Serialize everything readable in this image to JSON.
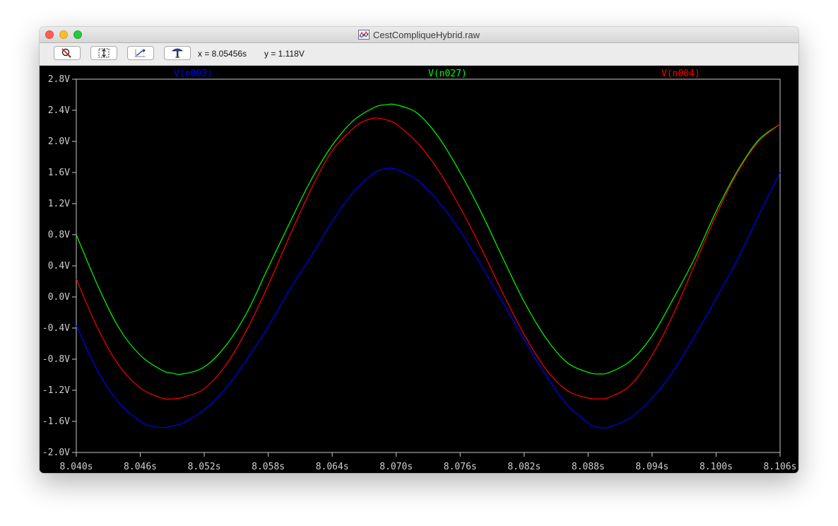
{
  "window": {
    "title": "CestCompliqueHybrid.raw"
  },
  "toolbar": {
    "buttons": [
      {
        "icon": "zoom-cancel-icon"
      },
      {
        "icon": "autorange-icon"
      },
      {
        "icon": "zoom-fit-icon"
      },
      {
        "icon": "probe-icon"
      }
    ],
    "x_readout": "x = 8.05456s",
    "y_readout": "y = 1.118V"
  },
  "chart_data": {
    "type": "line",
    "xlim": [
      8.04,
      8.106
    ],
    "ylim": [
      -2.0,
      2.8
    ],
    "x_ticks": [
      "8.040s",
      "8.046s",
      "8.052s",
      "8.058s",
      "8.064s",
      "8.070s",
      "8.076s",
      "8.082s",
      "8.088s",
      "8.094s",
      "8.100s",
      "8.106s"
    ],
    "y_ticks": [
      "2.8V",
      "2.4V",
      "2.0V",
      "1.6V",
      "1.2V",
      "0.8V",
      "0.4V",
      "0.0V",
      "-0.4V",
      "-0.8V",
      "-1.2V",
      "-1.6V",
      "-2.0V"
    ],
    "grid": false,
    "series": [
      {
        "name": "V(n003)",
        "color": "#0000ff",
        "x": [
          8.04,
          8.042,
          8.044,
          8.046,
          8.047,
          8.048,
          8.049,
          8.05,
          8.052,
          8.054,
          8.056,
          8.058,
          8.06,
          8.062,
          8.064,
          8.066,
          8.068,
          8.069,
          8.07,
          8.072,
          8.074,
          8.076,
          8.078,
          8.08,
          8.082,
          8.084,
          8.086,
          8.088,
          8.089,
          8.09,
          8.092,
          8.094,
          8.096,
          8.098,
          8.1,
          8.102,
          8.104,
          8.106
        ],
        "y": [
          -0.37,
          -0.95,
          -1.36,
          -1.6,
          -1.66,
          -1.68,
          -1.66,
          -1.62,
          -1.45,
          -1.18,
          -0.8,
          -0.38,
          0.09,
          0.52,
          0.97,
          1.35,
          1.6,
          1.65,
          1.64,
          1.5,
          1.22,
          0.85,
          0.4,
          -0.07,
          -0.55,
          -1.0,
          -1.38,
          -1.62,
          -1.68,
          -1.67,
          -1.55,
          -1.3,
          -0.95,
          -0.5,
          -0.02,
          0.48,
          1.05,
          1.6
        ]
      },
      {
        "name": "V(n027)",
        "color": "#00ff00",
        "x": [
          8.04,
          8.042,
          8.044,
          8.046,
          8.048,
          8.049,
          8.05,
          8.052,
          8.054,
          8.056,
          8.058,
          8.06,
          8.062,
          8.064,
          8.066,
          8.068,
          8.069,
          8.07,
          8.072,
          8.074,
          8.076,
          8.078,
          8.08,
          8.082,
          8.084,
          8.086,
          8.088,
          8.089,
          8.09,
          8.092,
          8.094,
          8.096,
          8.098,
          8.1,
          8.102,
          8.104,
          8.106
        ],
        "y": [
          0.8,
          0.15,
          -0.4,
          -0.75,
          -0.94,
          -0.98,
          -0.99,
          -0.9,
          -0.63,
          -0.2,
          0.38,
          0.95,
          1.5,
          1.95,
          2.27,
          2.44,
          2.47,
          2.47,
          2.36,
          2.05,
          1.6,
          1.08,
          0.5,
          -0.06,
          -0.52,
          -0.84,
          -0.97,
          -0.99,
          -0.97,
          -0.82,
          -0.5,
          -0.02,
          0.5,
          1.1,
          1.62,
          2.02,
          2.22
        ]
      },
      {
        "name": "V(n004)",
        "color": "#ff0000",
        "x": [
          8.04,
          8.042,
          8.044,
          8.046,
          8.048,
          8.049,
          8.05,
          8.052,
          8.054,
          8.056,
          8.058,
          8.06,
          8.062,
          8.064,
          8.066,
          8.067,
          8.068,
          8.069,
          8.07,
          8.072,
          8.074,
          8.076,
          8.078,
          8.08,
          8.082,
          8.084,
          8.086,
          8.088,
          8.089,
          8.09,
          8.092,
          8.094,
          8.096,
          8.098,
          8.1,
          8.102,
          8.104,
          8.106
        ],
        "y": [
          0.23,
          -0.4,
          -0.88,
          -1.17,
          -1.3,
          -1.31,
          -1.29,
          -1.18,
          -0.88,
          -0.42,
          0.15,
          0.78,
          1.38,
          1.88,
          2.17,
          2.26,
          2.3,
          2.28,
          2.22,
          1.98,
          1.62,
          1.15,
          0.62,
          0.05,
          -0.48,
          -0.92,
          -1.2,
          -1.3,
          -1.31,
          -1.29,
          -1.13,
          -0.75,
          -0.22,
          0.42,
          1.05,
          1.6,
          2.0,
          2.22
        ]
      }
    ]
  }
}
